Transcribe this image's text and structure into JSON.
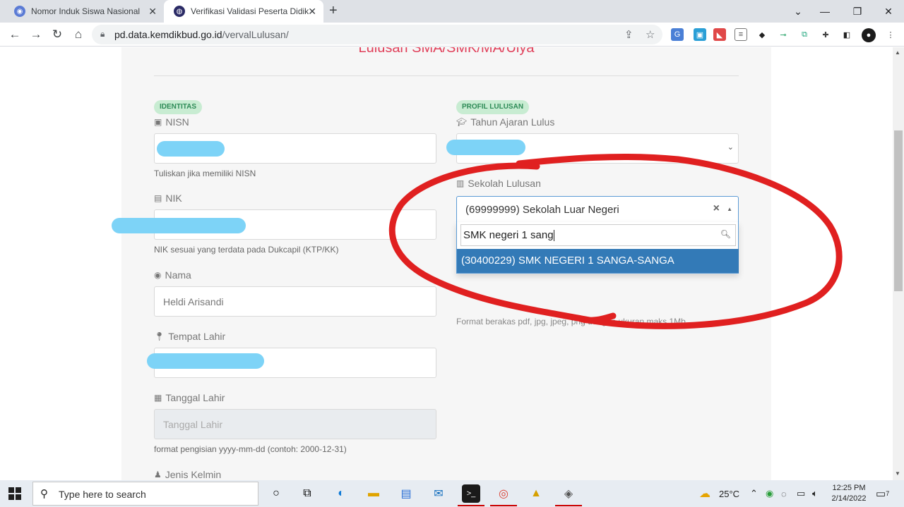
{
  "browser": {
    "tabs": [
      {
        "title": "Nomor Induk Siswa Nasional",
        "active": false
      },
      {
        "title": "Verifikasi Validasi Peserta Didik Lu",
        "active": true
      }
    ],
    "url_host": "pd.data.kemdikbud.go.id",
    "url_path": "/vervalLulusan/"
  },
  "page": {
    "heading": "Lulusan SMA/SMK/MA/Ulya",
    "identitas": {
      "badge": "IDENTITAS",
      "nisn_label": "NISN",
      "nisn_help": "Tuliskan jika memiliki NISN",
      "nik_label": "NIK",
      "nik_help": "NIK sesuai yang terdata pada Dukcapil (KTP/KK)",
      "nama_label": "Nama",
      "nama_value": "Heldi Arisandi",
      "tempat_label": "Tempat Lahir",
      "tanggal_label": "Tanggal Lahir",
      "tanggal_placeholder": "Tanggal Lahir",
      "tanggal_help": "format pengisian yyyy-mm-dd (contoh: 2000-12-31)",
      "jenis_label": "Jenis Kelmin"
    },
    "profil": {
      "badge": "PROFIL LULUSAN",
      "tahun_label": "Tahun Ajaran Lulus",
      "sekolah_label": "Sekolah Lulusan",
      "sekolah_selected": "(69999999) Sekolah Luar Negeri",
      "search_query": "SMK negeri 1 sang",
      "option": "(30400229) SMK NEGERI 1 SANGA-SANGA",
      "upload_help": "Format berakas pdf, jpg, jpeg, png dengan ukuran maks 1Mb"
    }
  },
  "taskbar": {
    "search_placeholder": "Type here to search",
    "weather": "25°C",
    "time": "12:25 PM",
    "date": "2/14/2022",
    "notifications": "7"
  },
  "colors": {
    "heading": "#e0405a",
    "badge_bg": "#c8ecd2",
    "option_highlight": "#337ab7",
    "annotation": "#e02020"
  }
}
